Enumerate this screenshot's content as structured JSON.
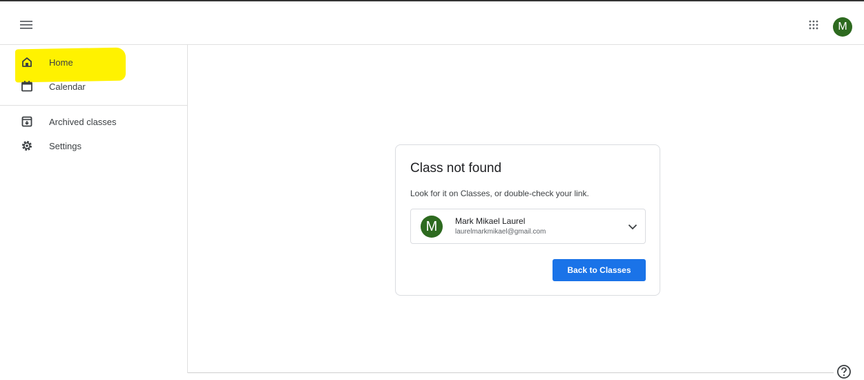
{
  "header": {
    "menu_icon": "hamburger-menu-icon",
    "apps_icon": "google-apps-grid-icon",
    "avatar_letter": "M",
    "avatar_color": "#2d6a1f"
  },
  "sidebar": {
    "highlight_color": "#fff200",
    "items": [
      {
        "label": "Home",
        "icon": "home-icon"
      },
      {
        "label": "Calendar",
        "icon": "calendar-icon"
      },
      {
        "label": "Archived classes",
        "icon": "archive-icon"
      },
      {
        "label": "Settings",
        "icon": "gear-icon"
      }
    ]
  },
  "card": {
    "title": "Class not found",
    "subtitle": "Look for it on Classes, or double-check your link.",
    "account": {
      "avatar_letter": "M",
      "name": "Mark Mikael Laurel",
      "email": "laurelmarkmikael@gmail.com"
    },
    "button_label": "Back to Classes",
    "button_color": "#1a73e8"
  },
  "help_icon": "help-icon"
}
